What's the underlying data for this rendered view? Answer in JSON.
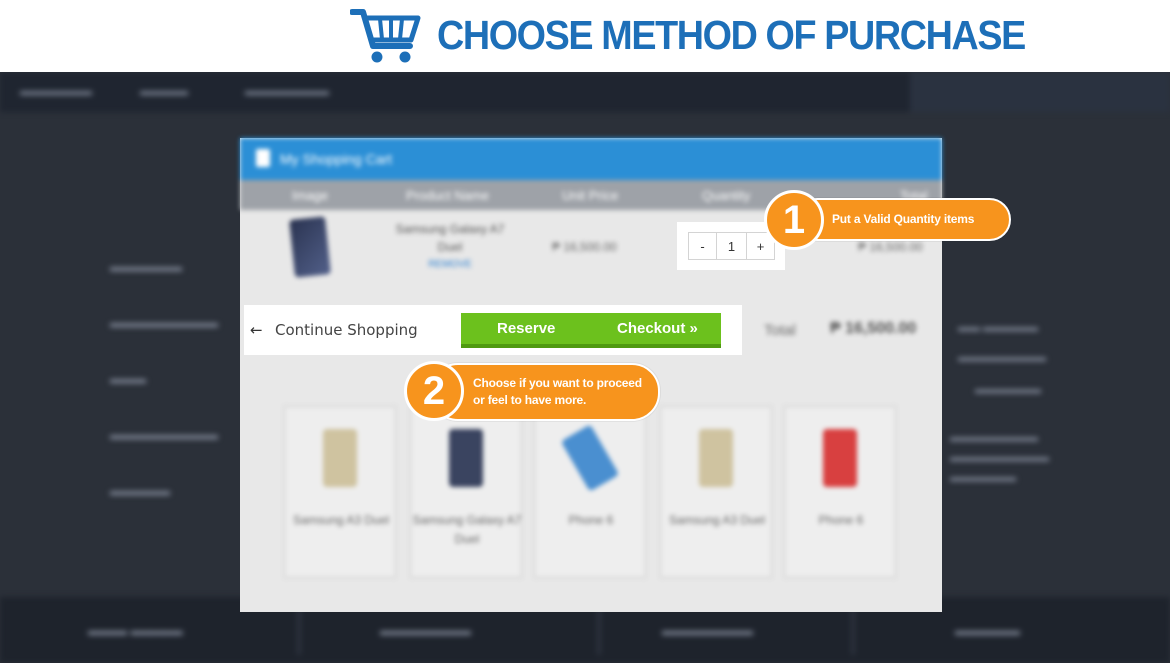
{
  "banner": {
    "title": "CHOOSE METHOD OF PURCHASE",
    "icon": "shopping-cart-icon",
    "title_color": "#1d6fb8"
  },
  "modal": {
    "title": "My Shopping Cart",
    "header_color": "#2b8fd6",
    "columns": [
      "Image",
      "Product Name",
      "Unit Price",
      "Quantity",
      "Total"
    ],
    "item": {
      "name": "Samsung Galaxy A7 Duel",
      "remove": "REMOVE",
      "unit_price": "₱ 16,500.00",
      "total": "₱ 16,500.00"
    },
    "total_label": "Total",
    "total_value": "₱ 16,500.00"
  },
  "quantity": {
    "minus": "-",
    "value": "1",
    "plus": "+"
  },
  "actions": {
    "continue_label": "Continue Shopping",
    "reserve_label": "Reserve",
    "checkout_label": "Checkout »",
    "button_color": "#6cc11d"
  },
  "products": [
    {
      "name": "Samsung A3 Duel",
      "color": "#cfc3a0"
    },
    {
      "name": "Samsung Galaxy A7 Duel",
      "color": "#3a4460"
    },
    {
      "name": "Phone 6",
      "color": "#4a8fd0"
    },
    {
      "name": "Samsung A3 Duel",
      "color": "#cfc3a0"
    },
    {
      "name": "Phone 6",
      "color": "#d84040"
    }
  ],
  "callouts": [
    {
      "number": "1",
      "text": "Put a Valid Quantity items"
    },
    {
      "number": "2",
      "text_line1": "Choose if you want to proceed",
      "text_line2": "or feel to have more."
    }
  ],
  "accent_color": "#f7941d"
}
